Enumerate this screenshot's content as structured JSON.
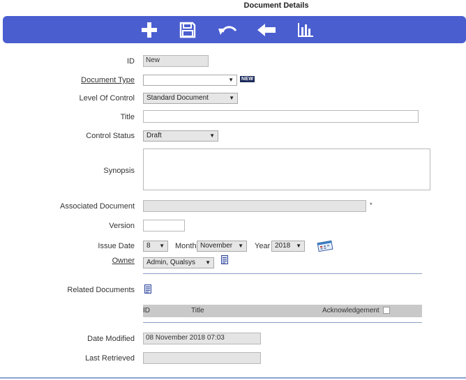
{
  "page": {
    "title": "Document Details"
  },
  "toolbar": {
    "buttons": [
      {
        "icon": "plus-icon"
      },
      {
        "icon": "save-icon"
      },
      {
        "icon": "undo-icon"
      },
      {
        "icon": "back-arrow-icon"
      },
      {
        "icon": "bar-chart-icon"
      }
    ]
  },
  "form": {
    "id": {
      "label": "ID",
      "value": "New"
    },
    "document_type": {
      "label": "Document Type",
      "value": "",
      "badge": "NEW"
    },
    "level_of_control": {
      "label": "Level Of Control",
      "value": "Standard Document"
    },
    "title": {
      "label": "Title",
      "value": ""
    },
    "control_status": {
      "label": "Control Status",
      "value": "Draft"
    },
    "synopsis": {
      "label": "Synopsis",
      "value": ""
    },
    "associated_document": {
      "label": "Associated Document",
      "value": "",
      "marker": "*"
    },
    "version": {
      "label": "Version",
      "value": ""
    },
    "issue_date": {
      "label": "Issue Date",
      "day": "8",
      "month_label": "Month",
      "month": "November",
      "year_label": "Year",
      "year": "2018"
    },
    "owner": {
      "label": "Owner",
      "value": "Admin, Qualsys"
    },
    "related_documents": {
      "label": "Related Documents",
      "columns": {
        "id": "ID",
        "title": "Title",
        "acknowledgement": "Acknowledgement"
      }
    },
    "date_modified": {
      "label": "Date Modified",
      "value": "08 November 2018 07:03"
    },
    "last_retrieved": {
      "label": "Last Retrieved",
      "value": ""
    }
  }
}
